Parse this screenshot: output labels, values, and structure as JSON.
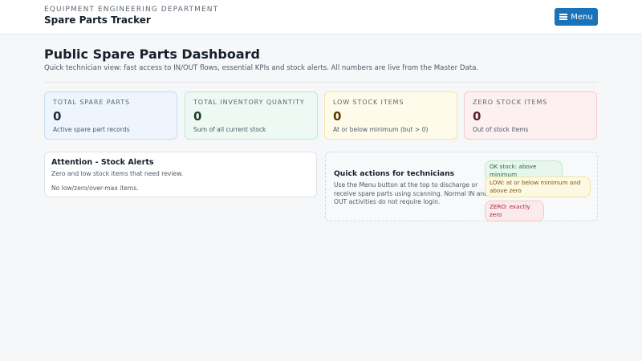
{
  "header": {
    "department": "EQUIPMENT ENGINEERING DEPARTMENT",
    "app_title": "Spare Parts Tracker",
    "menu_label": "Menu",
    "menu_icon": "hamburger-icon"
  },
  "page": {
    "title": "Public Spare Parts Dashboard",
    "subtitle": "Quick technician view: fast access to IN/OUT flows, essential KPIs and stock alerts. All numbers are live from the Master Data."
  },
  "kpis": [
    {
      "label": "TOTAL SPARE PARTS",
      "value": "0",
      "desc": "Active spare part records",
      "color": "#eef5fd"
    },
    {
      "label": "TOTAL INVENTORY QUANTITY",
      "value": "0",
      "desc": "Sum of all current stock",
      "color": "#edf9f2"
    },
    {
      "label": "LOW STOCK ITEMS",
      "value": "0",
      "desc": "At or below minimum (but > 0)",
      "color": "#fefbea"
    },
    {
      "label": "ZERO STOCK ITEMS",
      "value": "0",
      "desc": "Out of stock items",
      "color": "#fdf0f1"
    }
  ],
  "alerts": {
    "title": "Attention - Stock Alerts",
    "subtitle": "Zero and low stock items that need review.",
    "empty_text": "No low/zero/over-max items."
  },
  "quick_actions": {
    "title": "Quick actions for technicians",
    "text": "Use the Menu button at the top to discharge or receive spare parts using scanning. Normal IN and OUT activities do not require login.",
    "legend": [
      {
        "label": "OK stock: above minimum",
        "color": "#1f6b40"
      },
      {
        "label": "LOW: at or below minimum and above zero",
        "color": "#7a5a0c"
      },
      {
        "label": "ZERO: exactly zero",
        "color": "#a62638"
      }
    ]
  },
  "colors": {
    "accent": "#1a73b8",
    "background": "#f6f7f9"
  }
}
